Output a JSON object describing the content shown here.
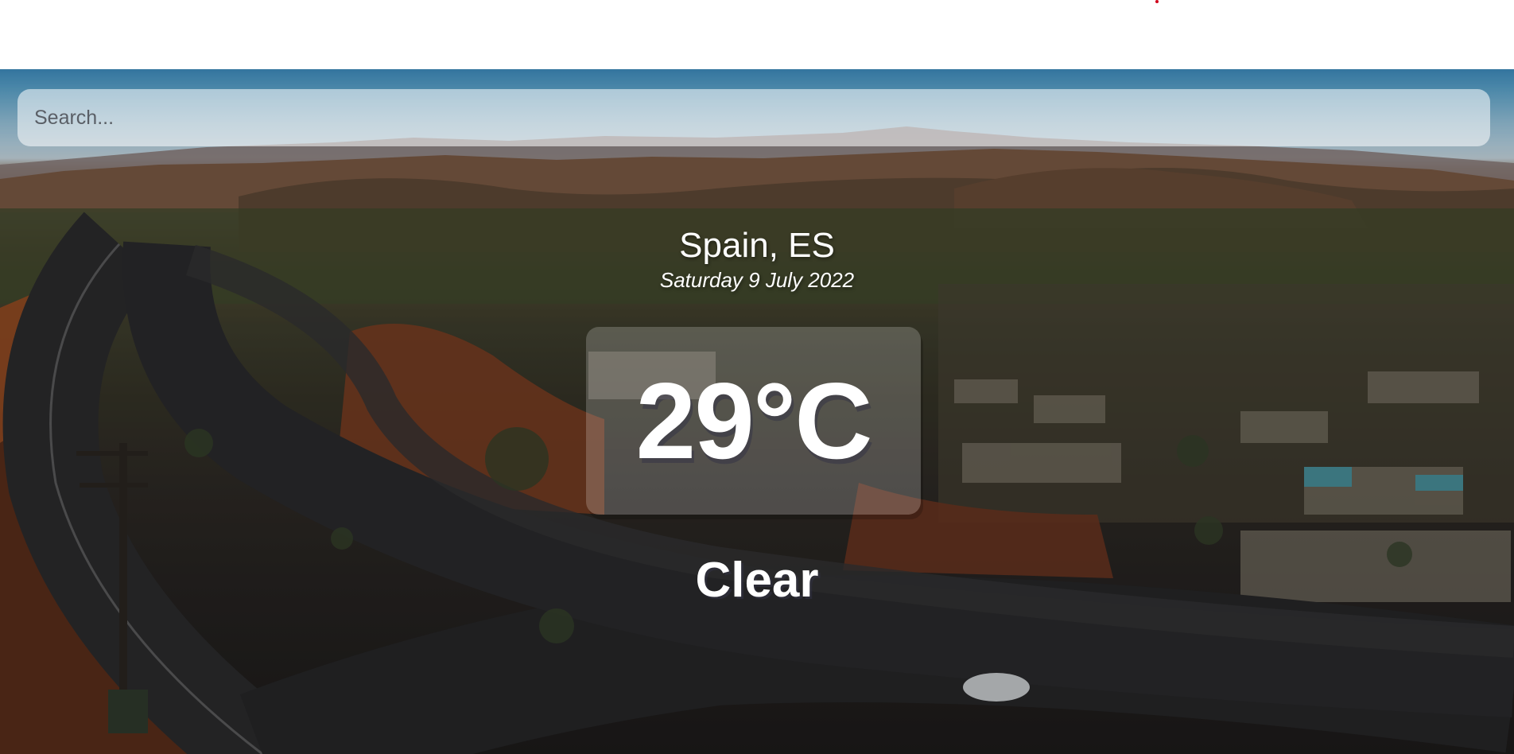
{
  "search": {
    "placeholder": "Search...",
    "value": ""
  },
  "weather": {
    "location": "Spain, ES",
    "date": "Saturday 9 July 2022",
    "temperature": "29°C",
    "condition": "Clear"
  },
  "colors": {
    "accent_dot": "#d0021b",
    "text": "#ffffff"
  }
}
